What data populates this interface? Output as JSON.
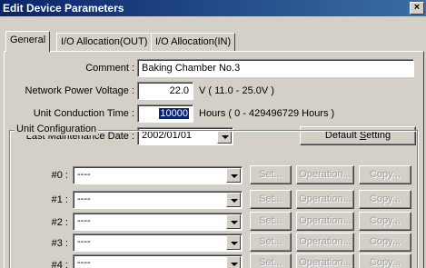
{
  "window": {
    "title": "Edit Device Parameters",
    "close_label": "×"
  },
  "tabs": [
    {
      "label": "General"
    },
    {
      "label": "I/O Allocation(OUT)"
    },
    {
      "label": "I/O Allocation(IN)"
    }
  ],
  "general": {
    "comment_label": "Comment :",
    "comment_value": "Baking Chamber No.3",
    "voltage_label": "Network Power Voltage :",
    "voltage_value": "22.0",
    "voltage_unit": "V ( 11.0 - 25.0V )",
    "conduction_label": "Unit Conduction Time :",
    "conduction_value": "10000",
    "conduction_unit": "Hours ( 0 - 429496729 Hours )",
    "maintenance_label": "Last Maintenance Date :",
    "maintenance_value": "2002/01/01",
    "default_button": "Default Setting",
    "default_button_prefix": "Default ",
    "default_button_accel": "S",
    "default_button_rest": "etting"
  },
  "unit_config": {
    "label": "Unit Configuration",
    "set_label": "Set...",
    "operation_label": "Operation...",
    "copy_label": "Copy...",
    "rows": [
      {
        "label": "#0 :",
        "value": "----"
      },
      {
        "label": "#1 :",
        "value": "----"
      },
      {
        "label": "#2 :",
        "value": "----"
      },
      {
        "label": "#3 :",
        "value": "----"
      },
      {
        "label": "#4 :",
        "value": "----"
      }
    ]
  }
}
